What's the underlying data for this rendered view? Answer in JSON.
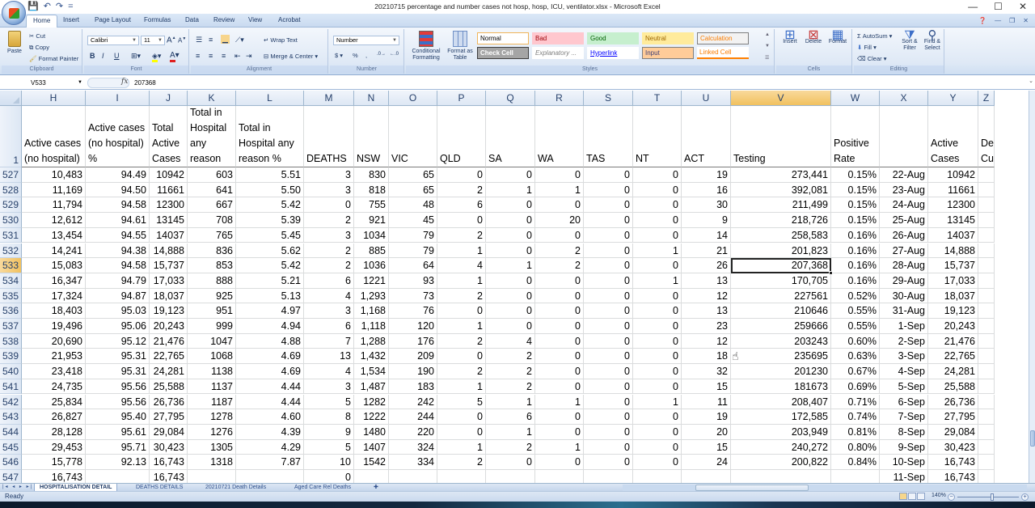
{
  "window": {
    "title": "20210715 percentage and number cases not hosp, hosp, ICU, ventilator.xlsx - Microsoft Excel",
    "minimize_icon": "—",
    "maximize_icon": "☐",
    "close_icon": "✕"
  },
  "quick_access": {
    "save_icon": "💾",
    "undo_icon": "↶",
    "redo_icon": "↷",
    "customize_icon": "="
  },
  "ribbon_tabs": [
    "Home",
    "Insert",
    "Page Layout",
    "Formulas",
    "Data",
    "Review",
    "View",
    "Acrobat"
  ],
  "active_ribbon_tab": "Home",
  "ribbon": {
    "clipboard": {
      "label": "Clipboard",
      "paste": "Paste",
      "cut": "Cut",
      "copy": "Copy",
      "format_painter": "Format Painter"
    },
    "font": {
      "label": "Font",
      "font_name": "Calibri",
      "font_size": "11",
      "bold": "B",
      "italic": "I",
      "underline": "U"
    },
    "alignment": {
      "label": "Alignment",
      "wrap_text": "Wrap Text",
      "merge_center": "Merge & Center"
    },
    "number": {
      "label": "Number",
      "format": "Number",
      "currency": "$",
      "percent": "%",
      "comma": ","
    },
    "styles": {
      "label": "Styles",
      "conditional_formatting": "Conditional Formatting",
      "format_as_table": "Format as Table",
      "cells": [
        {
          "name": "Normal",
          "bg": "#ffffff",
          "fg": "#000000",
          "border": "#f0b55a"
        },
        {
          "name": "Bad",
          "bg": "#ffc7ce",
          "fg": "#9c0006",
          "border": "#ffc7ce"
        },
        {
          "name": "Good",
          "bg": "#c6efce",
          "fg": "#006100",
          "border": "#c6efce"
        },
        {
          "name": "Neutral",
          "bg": "#ffeb9c",
          "fg": "#9c6500",
          "border": "#ffeb9c"
        },
        {
          "name": "Calculation",
          "bg": "#f2f2f2",
          "fg": "#fa7d00",
          "border": "#7f7f7f"
        },
        {
          "name": "Check Cell",
          "bg": "#a5a5a5",
          "fg": "#ffffff",
          "border": "#3f3f3f"
        },
        {
          "name": "Explanatory ...",
          "bg": "#ffffff",
          "fg": "#7f7f7f",
          "border": "#ffffff"
        },
        {
          "name": "Hyperlink",
          "bg": "#ffffff",
          "fg": "#0000ff",
          "border": "#ffffff"
        },
        {
          "name": "Input",
          "bg": "#ffcc99",
          "fg": "#3f3f76",
          "border": "#7f7f7f"
        },
        {
          "name": "Linked Cell",
          "bg": "#ffffff",
          "fg": "#fa7d00",
          "border": "#ff8001"
        }
      ]
    },
    "cells": {
      "label": "Cells",
      "insert": "Insert",
      "delete": "Delete",
      "format": "Format"
    },
    "editing": {
      "label": "Editing",
      "autosum": "AutoSum",
      "fill": "Fill",
      "clear": "Clear",
      "sort_filter": "Sort & Filter",
      "find_select": "Find & Select"
    }
  },
  "formula_bar": {
    "name_box": "V533",
    "fx_label": "fx",
    "formula": "207368"
  },
  "sheet": {
    "columns": [
      {
        "letter": "H",
        "header": "Active cases (no hospital)"
      },
      {
        "letter": "I",
        "header": "Active cases (no hospital) %"
      },
      {
        "letter": "J",
        "header": "Total Active Cases"
      },
      {
        "letter": "K",
        "header": "Total in Hospital any reason"
      },
      {
        "letter": "L",
        "header": "Total in Hospital any reason %"
      },
      {
        "letter": "M",
        "header": "DEATHS"
      },
      {
        "letter": "N",
        "header": "NSW"
      },
      {
        "letter": "O",
        "header": "VIC"
      },
      {
        "letter": "P",
        "header": "QLD"
      },
      {
        "letter": "Q",
        "header": "SA"
      },
      {
        "letter": "R",
        "header": "WA"
      },
      {
        "letter": "S",
        "header": "TAS"
      },
      {
        "letter": "T",
        "header": "NT"
      },
      {
        "letter": "U",
        "header": "ACT"
      },
      {
        "letter": "V",
        "header": "Testing"
      },
      {
        "letter": "W",
        "header": "Positive Rate"
      },
      {
        "letter": "X",
        "header": ""
      },
      {
        "letter": "Y",
        "header": "Active Cases"
      },
      {
        "letter": "Z",
        "header": "De Cu"
      }
    ],
    "header_row_number": "1",
    "active_cell": "V533",
    "active_column": "V",
    "active_row": "533",
    "rows": [
      {
        "num": "527",
        "cells": [
          "10,483",
          "94.49",
          "10942",
          "603",
          "5.51",
          "3",
          "830",
          "65",
          "0",
          "0",
          "0",
          "0",
          "0",
          "19",
          "273,441",
          "0.15%",
          "22-Aug",
          "10942",
          ""
        ]
      },
      {
        "num": "528",
        "cells": [
          "11,169",
          "94.50",
          "11661",
          "641",
          "5.50",
          "3",
          "818",
          "65",
          "2",
          "1",
          "1",
          "0",
          "0",
          "16",
          "392,081",
          "0.15%",
          "23-Aug",
          "11661",
          ""
        ]
      },
      {
        "num": "529",
        "cells": [
          "11,794",
          "94.58",
          "12300",
          "667",
          "5.42",
          "0",
          "755",
          "48",
          "6",
          "0",
          "0",
          "0",
          "0",
          "30",
          "211,499",
          "0.15%",
          "24-Aug",
          "12300",
          ""
        ]
      },
      {
        "num": "530",
        "cells": [
          "12,612",
          "94.61",
          "13145",
          "708",
          "5.39",
          "2",
          "921",
          "45",
          "0",
          "0",
          "20",
          "0",
          "0",
          "9",
          "218,726",
          "0.15%",
          "25-Aug",
          "13145",
          ""
        ]
      },
      {
        "num": "531",
        "cells": [
          "13,454",
          "94.55",
          "14037",
          "765",
          "5.45",
          "3",
          "1034",
          "79",
          "2",
          "0",
          "0",
          "0",
          "0",
          "14",
          "258,583",
          "0.16%",
          "26-Aug",
          "14037",
          ""
        ]
      },
      {
        "num": "532",
        "cells": [
          "14,241",
          "94.38",
          "14,888",
          "836",
          "5.62",
          "2",
          "885",
          "79",
          "1",
          "0",
          "2",
          "0",
          "1",
          "21",
          "201,823",
          "0.16%",
          "27-Aug",
          "14,888",
          ""
        ]
      },
      {
        "num": "533",
        "cells": [
          "15,083",
          "94.58",
          "15,737",
          "853",
          "5.42",
          "2",
          "1036",
          "64",
          "4",
          "1",
          "2",
          "0",
          "0",
          "26",
          "207,368",
          "0.16%",
          "28-Aug",
          "15,737",
          ""
        ]
      },
      {
        "num": "534",
        "cells": [
          "16,347",
          "94.79",
          "17,033",
          "888",
          "5.21",
          "6",
          "1221",
          "93",
          "1",
          "0",
          "0",
          "0",
          "1",
          "13",
          "170,705",
          "0.16%",
          "29-Aug",
          "17,033",
          ""
        ]
      },
      {
        "num": "535",
        "cells": [
          "17,324",
          "94.87",
          "18,037",
          "925",
          "5.13",
          "4",
          "1,293",
          "73",
          "2",
          "0",
          "0",
          "0",
          "0",
          "12",
          "227561",
          "0.52%",
          "30-Aug",
          "18,037",
          ""
        ]
      },
      {
        "num": "536",
        "cells": [
          "18,403",
          "95.03",
          "19,123",
          "951",
          "4.97",
          "3",
          "1,168",
          "76",
          "0",
          "0",
          "0",
          "0",
          "0",
          "13",
          "210646",
          "0.55%",
          "31-Aug",
          "19,123",
          ""
        ]
      },
      {
        "num": "537",
        "cells": [
          "19,496",
          "95.06",
          "20,243",
          "999",
          "4.94",
          "6",
          "1,118",
          "120",
          "1",
          "0",
          "0",
          "0",
          "0",
          "23",
          "259666",
          "0.55%",
          "1-Sep",
          "20,243",
          ""
        ]
      },
      {
        "num": "538",
        "cells": [
          "20,690",
          "95.12",
          "21,476",
          "1047",
          "4.88",
          "7",
          "1,288",
          "176",
          "2",
          "4",
          "0",
          "0",
          "0",
          "12",
          "203243",
          "0.60%",
          "2-Sep",
          "21,476",
          ""
        ]
      },
      {
        "num": "539",
        "cells": [
          "21,953",
          "95.31",
          "22,765",
          "1068",
          "4.69",
          "13",
          "1,432",
          "209",
          "0",
          "2",
          "0",
          "0",
          "0",
          "18",
          "235695",
          "0.63%",
          "3-Sep",
          "22,765",
          ""
        ]
      },
      {
        "num": "540",
        "cells": [
          "23,418",
          "95.31",
          "24,281",
          "1138",
          "4.69",
          "4",
          "1,534",
          "190",
          "2",
          "2",
          "0",
          "0",
          "0",
          "32",
          "201230",
          "0.67%",
          "4-Sep",
          "24,281",
          ""
        ]
      },
      {
        "num": "541",
        "cells": [
          "24,735",
          "95.56",
          "25,588",
          "1137",
          "4.44",
          "3",
          "1,487",
          "183",
          "1",
          "2",
          "0",
          "0",
          "0",
          "15",
          "181673",
          "0.69%",
          "5-Sep",
          "25,588",
          ""
        ]
      },
      {
        "num": "542",
        "cells": [
          "25,834",
          "95.56",
          "26,736",
          "1187",
          "4.44",
          "5",
          "1282",
          "242",
          "5",
          "1",
          "1",
          "0",
          "1",
          "11",
          "208,407",
          "0.71%",
          "6-Sep",
          "26,736",
          ""
        ]
      },
      {
        "num": "543",
        "cells": [
          "26,827",
          "95.40",
          "27,795",
          "1278",
          "4.60",
          "8",
          "1222",
          "244",
          "0",
          "6",
          "0",
          "0",
          "0",
          "19",
          "172,585",
          "0.74%",
          "7-Sep",
          "27,795",
          ""
        ]
      },
      {
        "num": "544",
        "cells": [
          "28,128",
          "95.61",
          "29,084",
          "1276",
          "4.39",
          "9",
          "1480",
          "220",
          "0",
          "1",
          "0",
          "0",
          "0",
          "20",
          "203,949",
          "0.81%",
          "8-Sep",
          "29,084",
          ""
        ]
      },
      {
        "num": "545",
        "cells": [
          "29,453",
          "95.71",
          "30,423",
          "1305",
          "4.29",
          "5",
          "1407",
          "324",
          "1",
          "2",
          "1",
          "0",
          "0",
          "15",
          "240,272",
          "0.80%",
          "9-Sep",
          "30,423",
          ""
        ]
      },
      {
        "num": "546",
        "cells": [
          "15,778",
          "92.13",
          "16,743",
          "1318",
          "7.87",
          "10",
          "1542",
          "334",
          "2",
          "0",
          "0",
          "0",
          "0",
          "24",
          "200,822",
          "0.84%",
          "10-Sep",
          "16,743",
          ""
        ]
      },
      {
        "num": "547",
        "cells": [
          "16,743",
          "",
          "16,743",
          "",
          "",
          "0",
          "",
          "",
          "",
          "",
          "",
          "",
          "",
          "",
          "",
          "",
          "11-Sep",
          "16,743",
          ""
        ]
      }
    ]
  },
  "sheet_tabs": [
    "HOSPITALISATION DETAIL",
    "DEATHS DETAILS",
    "20210721 Death Details",
    "Aged Care Rel Deaths"
  ],
  "active_sheet_tab": "HOSPITALISATION DETAIL",
  "status_bar": {
    "status": "Ready",
    "zoom_level": "140%",
    "zoom_percent": 140
  }
}
